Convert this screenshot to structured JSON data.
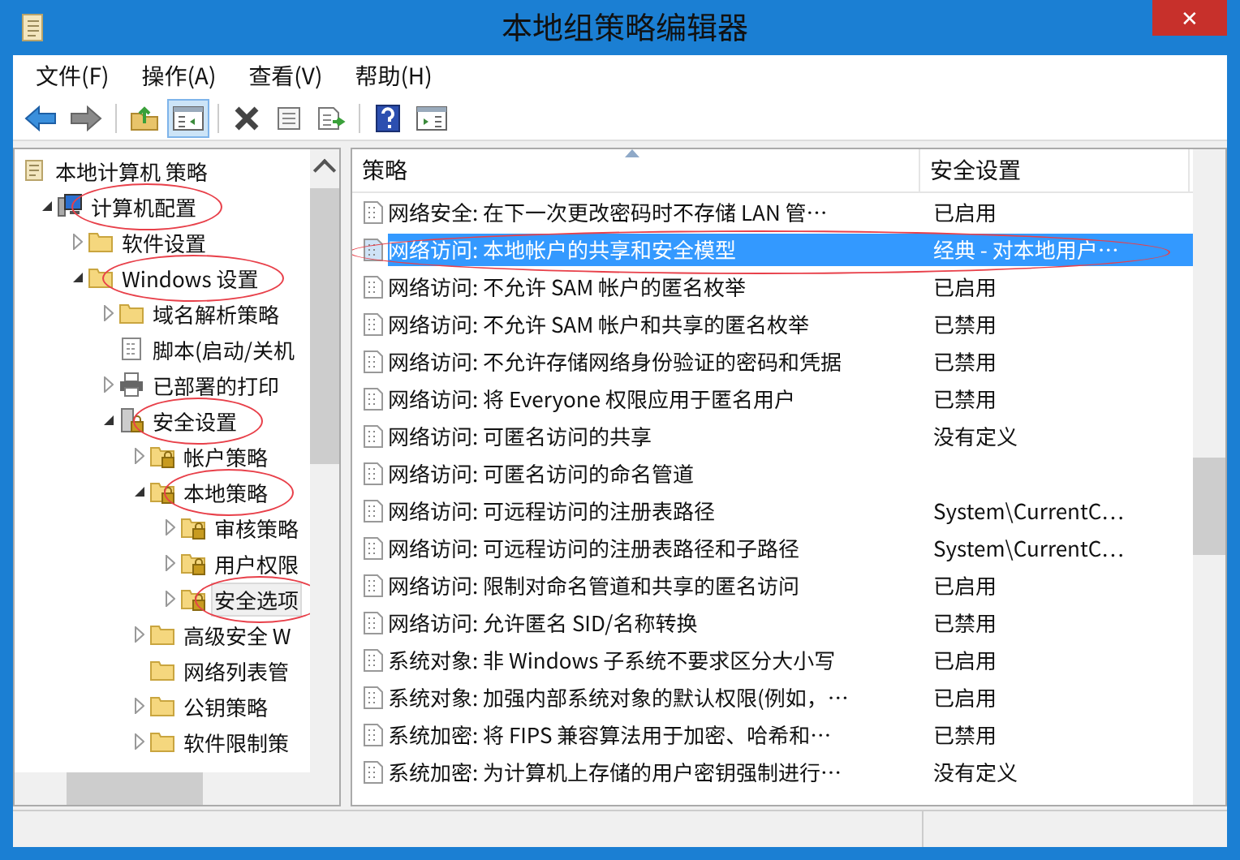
{
  "window": {
    "title": "本地组策略编辑器",
    "close": "✕"
  },
  "menu": [
    {
      "label": "文件(F)"
    },
    {
      "label": "操作(A)"
    },
    {
      "label": "查看(V)"
    },
    {
      "label": "帮助(H)"
    }
  ],
  "toolbar": [
    {
      "kind": "back",
      "pressed": false
    },
    {
      "kind": "forward",
      "pressed": false
    },
    {
      "kind": "sep"
    },
    {
      "kind": "up",
      "pressed": false
    },
    {
      "kind": "tree",
      "pressed": true
    },
    {
      "kind": "sep"
    },
    {
      "kind": "delete",
      "pressed": false
    },
    {
      "kind": "properties",
      "pressed": false
    },
    {
      "kind": "export",
      "pressed": false
    },
    {
      "kind": "sep"
    },
    {
      "kind": "help",
      "pressed": false
    },
    {
      "kind": "pane",
      "pressed": false
    }
  ],
  "tree": [
    {
      "label": "本地计算机 策略",
      "kind": "scroll",
      "selected": false,
      "circled": false,
      "children": [
        {
          "label": "计算机配置",
          "kind": "computer",
          "expanded": true,
          "selected": false,
          "circled": true,
          "children": [
            {
              "label": "软件设置",
              "kind": "folder",
              "expanded": false,
              "selected": false,
              "circled": false
            },
            {
              "label": "Windows 设置",
              "kind": "folder",
              "expanded": true,
              "selected": false,
              "circled": true,
              "children": [
                {
                  "label": "域名解析策略",
                  "kind": "folder",
                  "expanded": false,
                  "selected": false,
                  "circled": false
                },
                {
                  "label": "脚本(启动/关机",
                  "kind": "script",
                  "selected": false,
                  "circled": false
                },
                {
                  "label": "已部署的打印",
                  "kind": "printer",
                  "expanded": false,
                  "selected": false,
                  "circled": false
                },
                {
                  "label": "安全设置",
                  "kind": "security",
                  "expanded": true,
                  "selected": false,
                  "circled": true,
                  "children": [
                    {
                      "label": "帐户策略",
                      "kind": "lockfolder",
                      "expanded": false,
                      "selected": false,
                      "circled": false
                    },
                    {
                      "label": "本地策略",
                      "kind": "lockfolder",
                      "expanded": true,
                      "selected": false,
                      "circled": true,
                      "children": [
                        {
                          "label": "审核策略",
                          "kind": "lockfolder",
                          "expanded": false,
                          "selected": false,
                          "circled": false
                        },
                        {
                          "label": "用户权限",
                          "kind": "lockfolder",
                          "expanded": false,
                          "selected": false,
                          "circled": false
                        },
                        {
                          "label": "安全选项",
                          "kind": "lockfolder",
                          "expanded": false,
                          "selected": true,
                          "circled": true
                        }
                      ]
                    },
                    {
                      "label": "高级安全 W",
                      "kind": "folder",
                      "expanded": false,
                      "selected": false,
                      "circled": false
                    },
                    {
                      "label": "网络列表管",
                      "kind": "folder",
                      "selected": false,
                      "circled": false
                    },
                    {
                      "label": "公钥策略",
                      "kind": "folder",
                      "expanded": false,
                      "selected": false,
                      "circled": false
                    },
                    {
                      "label": "软件限制策",
                      "kind": "folder",
                      "expanded": false,
                      "selected": false,
                      "circled": false
                    }
                  ]
                }
              ]
            }
          ]
        }
      ]
    }
  ],
  "table": {
    "columns": [
      "策略",
      "安全设置"
    ],
    "rows": [
      {
        "policy": "网络安全: 在下一次更改密码时不存储 LAN 管…",
        "setting": "已启用",
        "selected": false,
        "circled": false
      },
      {
        "policy": "网络访问: 本地帐户的共享和安全模型",
        "setting": "经典 - 对本地用户…",
        "selected": true,
        "circled": true
      },
      {
        "policy": "网络访问: 不允许 SAM 帐户的匿名枚举",
        "setting": "已启用",
        "selected": false,
        "circled": false
      },
      {
        "policy": "网络访问: 不允许 SAM 帐户和共享的匿名枚举",
        "setting": "已禁用",
        "selected": false,
        "circled": false
      },
      {
        "policy": "网络访问: 不允许存储网络身份验证的密码和凭据",
        "setting": "已禁用",
        "selected": false,
        "circled": false
      },
      {
        "policy": "网络访问: 将 Everyone 权限应用于匿名用户",
        "setting": "已禁用",
        "selected": false,
        "circled": false
      },
      {
        "policy": "网络访问: 可匿名访问的共享",
        "setting": "没有定义",
        "selected": false,
        "circled": false
      },
      {
        "policy": "网络访问: 可匿名访问的命名管道",
        "selected": false,
        "circled": false
      },
      {
        "policy": "网络访问: 可远程访问的注册表路径",
        "setting": "System\\CurrentC…",
        "selected": false,
        "circled": false
      },
      {
        "policy": "网络访问: 可远程访问的注册表路径和子路径",
        "setting": "System\\CurrentC…",
        "selected": false,
        "circled": false
      },
      {
        "policy": "网络访问: 限制对命名管道和共享的匿名访问",
        "setting": "已启用",
        "selected": false,
        "circled": false
      },
      {
        "policy": "网络访问: 允许匿名 SID/名称转换",
        "setting": "已禁用",
        "selected": false,
        "circled": false
      },
      {
        "policy": "系统对象: 非 Windows 子系统不要求区分大小写",
        "setting": "已启用",
        "selected": false,
        "circled": false
      },
      {
        "policy": "系统对象: 加强内部系统对象的默认权限(例如，…",
        "setting": "已启用",
        "selected": false,
        "circled": false
      },
      {
        "policy": "系统加密: 将 FIPS 兼容算法用于加密、哈希和…",
        "setting": "已禁用",
        "selected": false,
        "circled": false
      },
      {
        "policy": "系统加密: 为计算机上存储的用户密钥强制进行…",
        "setting": "没有定义",
        "selected": false,
        "circled": false
      }
    ]
  }
}
